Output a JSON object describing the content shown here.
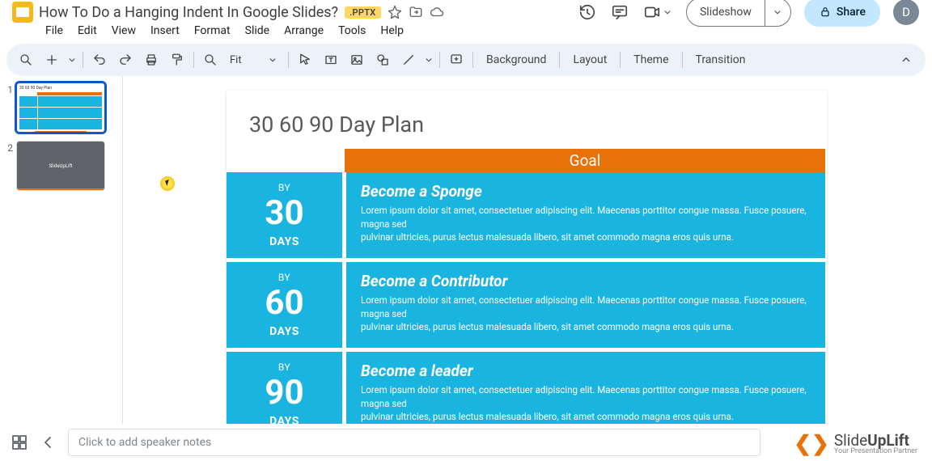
{
  "header": {
    "title": "How To Do a Hanging Indent In Google Slides?",
    "badge": ".PPTX",
    "slideshow": "Slideshow",
    "share": "Share",
    "user_initial": "D"
  },
  "menu": [
    "File",
    "Edit",
    "View",
    "Insert",
    "Format",
    "Slide",
    "Arrange",
    "Tools",
    "Help"
  ],
  "toolbar": {
    "zoom": "Fit",
    "background": "Background",
    "layout": "Layout",
    "theme": "Theme",
    "transition": "Transition"
  },
  "thumbs": [
    {
      "num": "1"
    },
    {
      "num": "2",
      "label": "SlideUpLift"
    }
  ],
  "slide": {
    "title": "30 60 90 Day Plan",
    "goal_header": "Goal",
    "rows": [
      {
        "by": "BY",
        "num": "30",
        "days": "DAYS",
        "heading": "Become a Sponge",
        "body": "Lorem ipsum dolor sit amet, consectetuer adipiscing elit. Maecenas porttitor congue massa. Fusce posuere, magna sed\npulvinar ultricies, purus lectus malesuada libero, sit amet commodo magna eros quis urna."
      },
      {
        "by": "BY",
        "num": "60",
        "days": "DAYS",
        "heading": "Become a Contributor",
        "body": "Lorem ipsum dolor sit amet, consectetuer adipiscing elit. Maecenas porttitor congue massa. Fusce posuere, magna sed\npulvinar ultricies, purus lectus malesuada libero, sit amet commodo magna eros quis urna."
      },
      {
        "by": "BY",
        "num": "90",
        "days": "DAYS",
        "heading": "Become a leader",
        "body": "Lorem ipsum dolor sit amet, consectetuer adipiscing elit. Maecenas porttitor congue massa. Fusce posuere, magna sed\npulvinar ultricies, purus lectus malesuada libero, sit amet commodo magna eros quis urna."
      }
    ]
  },
  "notes_placeholder": "Click to add speaker notes",
  "brand": {
    "name_a": "Slide",
    "name_b": "UpLift",
    "tag": "Your Presentation Partner"
  }
}
